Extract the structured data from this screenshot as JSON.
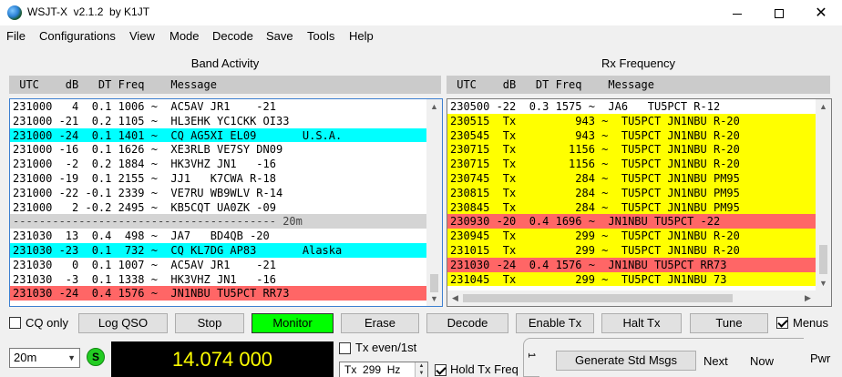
{
  "window": {
    "app_name": "WSJT-X",
    "version": "v2.1.2",
    "author": "by K1JT",
    "minimize": "—",
    "close": "✕"
  },
  "menu": [
    "File",
    "Configurations",
    "View",
    "Mode",
    "Decode",
    "Save",
    "Tools",
    "Help"
  ],
  "band_activity": {
    "title": "Band Activity",
    "header": " UTC    dB   DT Freq    Message",
    "rows": [
      {
        "text": "231000   4  0.1 1006 ~  AC5AV JR1    -21",
        "style": "white"
      },
      {
        "text": "231000 -21  0.2 1105 ~  HL3EHK YC1CKK OI33",
        "style": "white"
      },
      {
        "text": "231000 -24  0.1 1401 ~  CQ AG5XI EL09       U.S.A.",
        "style": "cyan"
      },
      {
        "text": "231000 -16  0.1 1626 ~  XE3RLB VE7SY DN09",
        "style": "white"
      },
      {
        "text": "231000  -2  0.2 1884 ~  HK3VHZ JN1   -16",
        "style": "white"
      },
      {
        "text": "231000 -19  0.1 2155 ~  JJ1   K7CWA R-18",
        "style": "white"
      },
      {
        "text": "231000 -22 -0.1 2339 ~  VE7RU WB9WLV R-14",
        "style": "white"
      },
      {
        "text": "231000   2 -0.2 2495 ~  KB5CQT UA0ZK -09",
        "style": "white"
      },
      {
        "text": "---------------------------------------- 20m",
        "style": "sep"
      },
      {
        "text": "231030  13  0.4  498 ~  JA7   BD4QB -20",
        "style": "white"
      },
      {
        "text": "231030 -23  0.1  732 ~  CQ KL7DG AP83       Alaska",
        "style": "cyan"
      },
      {
        "text": "231030   0  0.1 1007 ~  AC5AV JR1    -21",
        "style": "white"
      },
      {
        "text": "231030  -3  0.1 1338 ~  HK3VHZ JN1   -16",
        "style": "white"
      },
      {
        "text": "231030 -24  0.4 1576 ~  JN1NBU TU5PCT RR73",
        "style": "red"
      }
    ]
  },
  "rx_frequency": {
    "title": "Rx Frequency",
    "header": " UTC    dB   DT Freq    Message",
    "rows": [
      {
        "text": "230500 -22  0.3 1575 ~  JA6   TU5PCT R-12",
        "style": "white"
      },
      {
        "text": "230515  Tx         943 ~  TU5PCT JN1NBU R-20",
        "style": "yellow"
      },
      {
        "text": "230545  Tx         943 ~  TU5PCT JN1NBU R-20",
        "style": "yellow"
      },
      {
        "text": "230715  Tx        1156 ~  TU5PCT JN1NBU R-20",
        "style": "yellow"
      },
      {
        "text": "230715  Tx        1156 ~  TU5PCT JN1NBU R-20",
        "style": "yellow"
      },
      {
        "text": "230745  Tx         284 ~  TU5PCT JN1NBU PM95",
        "style": "yellow"
      },
      {
        "text": "230815  Tx         284 ~  TU5PCT JN1NBU PM95",
        "style": "yellow"
      },
      {
        "text": "230845  Tx         284 ~  TU5PCT JN1NBU PM95",
        "style": "yellow"
      },
      {
        "text": "230930 -20  0.4 1696 ~  JN1NBU TU5PCT -22",
        "style": "red"
      },
      {
        "text": "230945  Tx         299 ~  TU5PCT JN1NBU R-20",
        "style": "yellow"
      },
      {
        "text": "231015  Tx         299 ~  TU5PCT JN1NBU R-20",
        "style": "yellow"
      },
      {
        "text": "231030 -24  0.4 1576 ~  JN1NBU TU5PCT RR73",
        "style": "red"
      },
      {
        "text": "231045  Tx         299 ~  TU5PCT JN1NBU 73",
        "style": "yellow"
      }
    ]
  },
  "controls": {
    "cq_only": "CQ only",
    "log_qso": "Log QSO",
    "stop": "Stop",
    "monitor": "Monitor",
    "erase": "Erase",
    "decode": "Decode",
    "enable_tx": "Enable Tx",
    "halt_tx": "Halt Tx",
    "tune": "Tune",
    "menus": "Menus"
  },
  "bottom": {
    "band": "20m",
    "s_badge": "S",
    "frequency": "14.074 000",
    "tx_even": "Tx even/1st",
    "tx_freq_prefix": "Tx",
    "tx_freq_value": "299",
    "tx_freq_unit": "Hz",
    "hold_tx_freq": "Hold Tx Freq",
    "tab_label": "1",
    "generate_std_msgs": "Generate Std Msgs",
    "next": "Next",
    "now": "Now",
    "pwr": "Pwr"
  },
  "colors": {
    "cq_highlight": "#00ffff",
    "tx_highlight": "#ffff00",
    "to_me_highlight": "#ff6666",
    "monitor_on": "#00ff00",
    "freq_text": "#ffff00"
  }
}
